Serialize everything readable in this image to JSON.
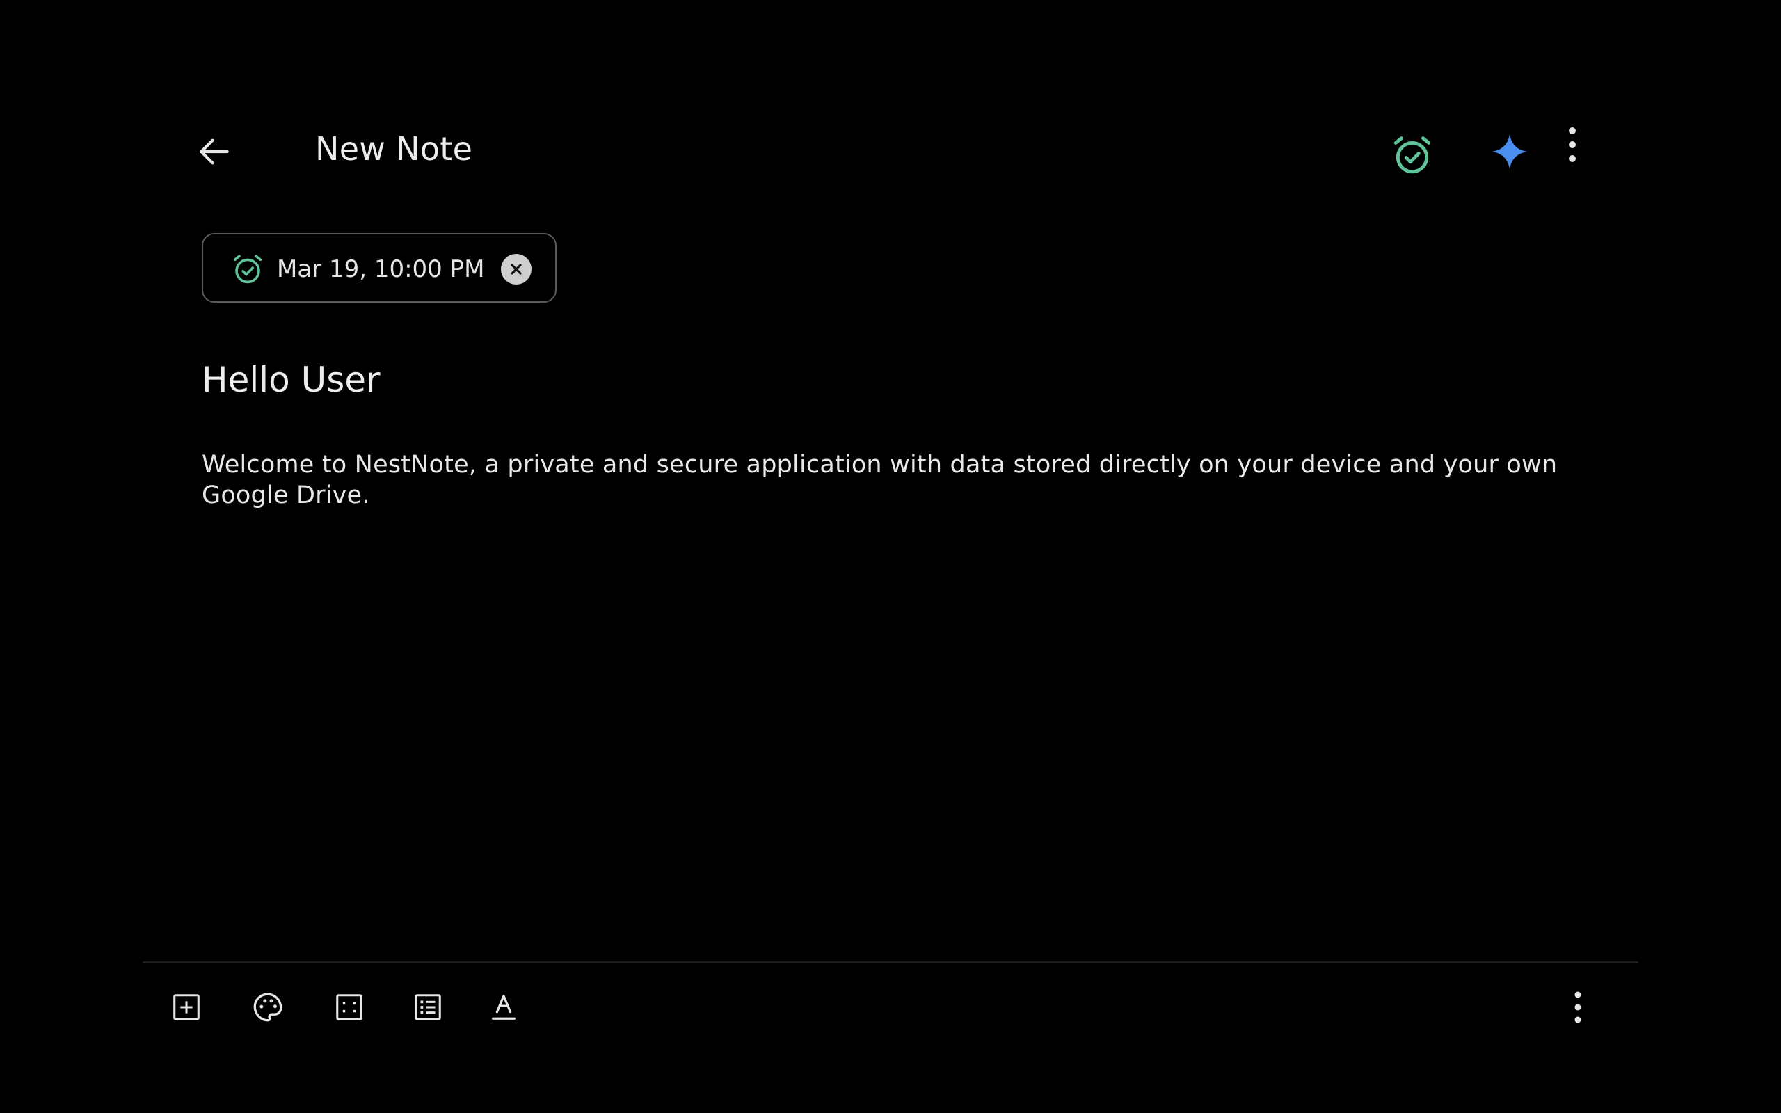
{
  "header": {
    "back_icon": "arrow-left-icon",
    "title": "New Note",
    "reminder_icon": "alarm-check-icon",
    "ai_icon": "sparkle-icon",
    "menu_icon": "more-vertical-icon"
  },
  "reminder_chip": {
    "icon": "alarm-check-icon",
    "label": "Mar 19, 10:00 PM",
    "clear_icon": "close-circle-icon"
  },
  "note": {
    "title": "Hello User",
    "body": "Welcome to NestNote, a private and secure application with data stored directly on your device and your own Google Drive."
  },
  "toolbar": {
    "items": [
      {
        "icon": "add-box-icon"
      },
      {
        "icon": "palette-icon"
      },
      {
        "icon": "checklist-grid-icon"
      },
      {
        "icon": "bulleted-list-icon"
      },
      {
        "icon": "text-format-icon"
      }
    ],
    "more_icon": "more-vertical-icon"
  },
  "colors": {
    "background": "#000000",
    "text": "#ececec",
    "reminder_accent": "#5fc49a",
    "ai_accent": "#4a8fef",
    "chip_border": "#5a5a5a"
  }
}
